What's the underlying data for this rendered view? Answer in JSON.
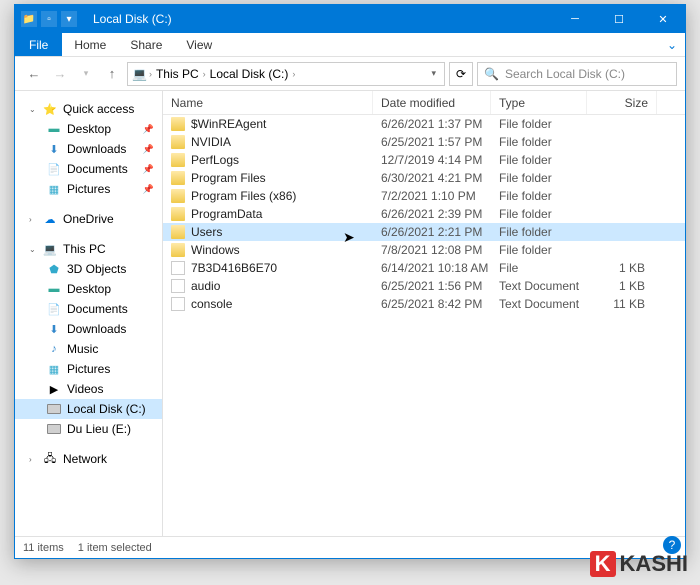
{
  "title": "Local Disk (C:)",
  "ribbon": {
    "file": "File",
    "home": "Home",
    "share": "Share",
    "view": "View"
  },
  "breadcrumb": {
    "pc": "This PC",
    "loc": "Local Disk (C:)"
  },
  "search_placeholder": "Search Local Disk (C:)",
  "columns": {
    "name": "Name",
    "date": "Date modified",
    "type": "Type",
    "size": "Size"
  },
  "sidebar": {
    "quick": "Quick access",
    "desktop": "Desktop",
    "downloads": "Downloads",
    "documents": "Documents",
    "pictures": "Pictures",
    "onedrive": "OneDrive",
    "thispc": "This PC",
    "objects3d": "3D Objects",
    "desktop2": "Desktop",
    "documents2": "Documents",
    "downloads2": "Downloads",
    "music": "Music",
    "pictures2": "Pictures",
    "videos": "Videos",
    "localdisk": "Local Disk (C:)",
    "dulieu": "Du Lieu (E:)",
    "network": "Network"
  },
  "files": [
    {
      "name": "$WinREAgent",
      "date": "6/26/2021 1:37 PM",
      "type": "File folder",
      "size": "",
      "icon": "folder"
    },
    {
      "name": "NVIDIA",
      "date": "6/25/2021 1:57 PM",
      "type": "File folder",
      "size": "",
      "icon": "folder"
    },
    {
      "name": "PerfLogs",
      "date": "12/7/2019 4:14 PM",
      "type": "File folder",
      "size": "",
      "icon": "folder"
    },
    {
      "name": "Program Files",
      "date": "6/30/2021 4:21 PM",
      "type": "File folder",
      "size": "",
      "icon": "folder"
    },
    {
      "name": "Program Files (x86)",
      "date": "7/2/2021 1:10 PM",
      "type": "File folder",
      "size": "",
      "icon": "folder"
    },
    {
      "name": "ProgramData",
      "date": "6/26/2021 2:39 PM",
      "type": "File folder",
      "size": "",
      "icon": "folder"
    },
    {
      "name": "Users",
      "date": "6/26/2021 2:21 PM",
      "type": "File folder",
      "size": "",
      "icon": "folder",
      "selected": true
    },
    {
      "name": "Windows",
      "date": "7/8/2021 12:08 PM",
      "type": "File folder",
      "size": "",
      "icon": "folder"
    },
    {
      "name": "7B3D416B6E70",
      "date": "6/14/2021 10:18 AM",
      "type": "File",
      "size": "1 KB",
      "icon": "file"
    },
    {
      "name": "audio",
      "date": "6/25/2021 1:56 PM",
      "type": "Text Document",
      "size": "1 KB",
      "icon": "file"
    },
    {
      "name": "console",
      "date": "6/25/2021 8:42 PM",
      "type": "Text Document",
      "size": "11 KB",
      "icon": "file"
    }
  ],
  "status": {
    "count": "11 items",
    "selected": "1 item selected"
  },
  "watermark": "KASHI"
}
